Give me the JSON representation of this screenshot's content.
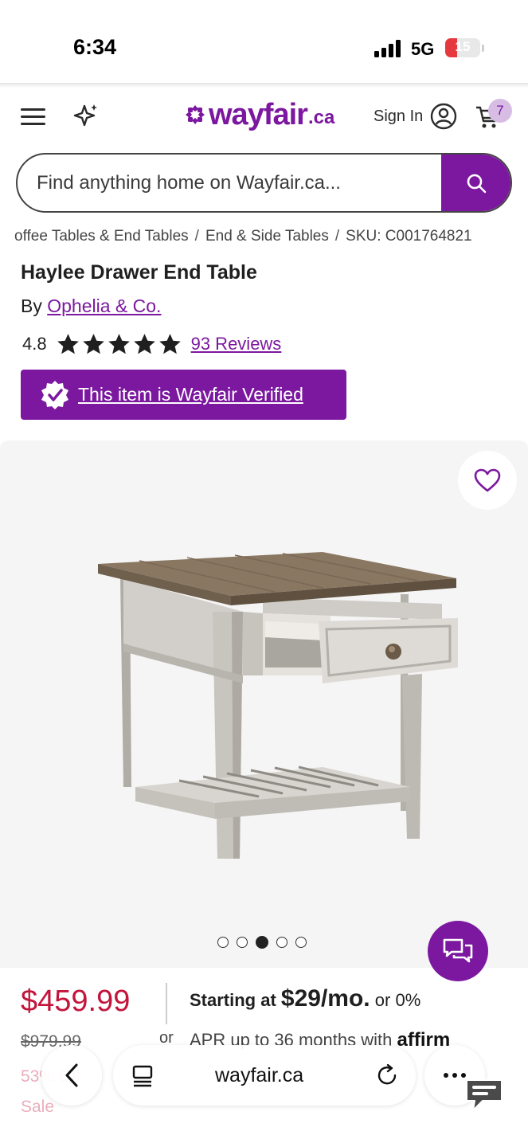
{
  "status_bar": {
    "time": "6:34",
    "network": "5G",
    "battery": "15",
    "battery_level": 0.15
  },
  "header": {
    "menu_icon": "hamburger-icon",
    "ai_icon": "sparkle-icon",
    "logo_text": "wayfair",
    "logo_tld": ".ca",
    "sign_in": "Sign In",
    "account_icon": "account-icon",
    "cart_icon": "cart-icon",
    "cart_count": "7"
  },
  "search": {
    "placeholder": "Find anything home on Wayfair.ca...",
    "icon": "search-icon"
  },
  "breadcrumb": {
    "items": [
      "offee Tables & End Tables",
      "End & Side Tables",
      "SKU: C001764821"
    ],
    "separator": "/"
  },
  "product": {
    "title": "Haylee Drawer End Table",
    "by_prefix": "By",
    "brand": "Ophelia & Co.",
    "rating": "4.8",
    "rating_value": 4.8,
    "reviews": "93 Reviews",
    "verified_label": "This item is Wayfair Verified"
  },
  "gallery": {
    "image_count": 5,
    "active_index": 2,
    "favorite_icon": "heart-icon",
    "chat_icon": "chat-icon"
  },
  "pricing": {
    "price": "$459.99",
    "original_price": "$979.99",
    "discount": "53% Off",
    "sale_label": "Sale",
    "financing_prefix": "Starting at",
    "financing_amount": "$29/mo.",
    "financing_suffix": "or 0%",
    "or_label": "or",
    "apr_text": "APR up to 36 months with",
    "affirm": "affirm"
  },
  "browser": {
    "url": "wayfair.ca",
    "back_icon": "chevron-left-icon",
    "tabs_icon": "tabs-icon",
    "reload_icon": "reload-icon",
    "more_icon": "more-icon"
  },
  "colors": {
    "brand": "#7b189f",
    "price": "#c3153c",
    "gallery_bg": "#f5f5f5"
  }
}
